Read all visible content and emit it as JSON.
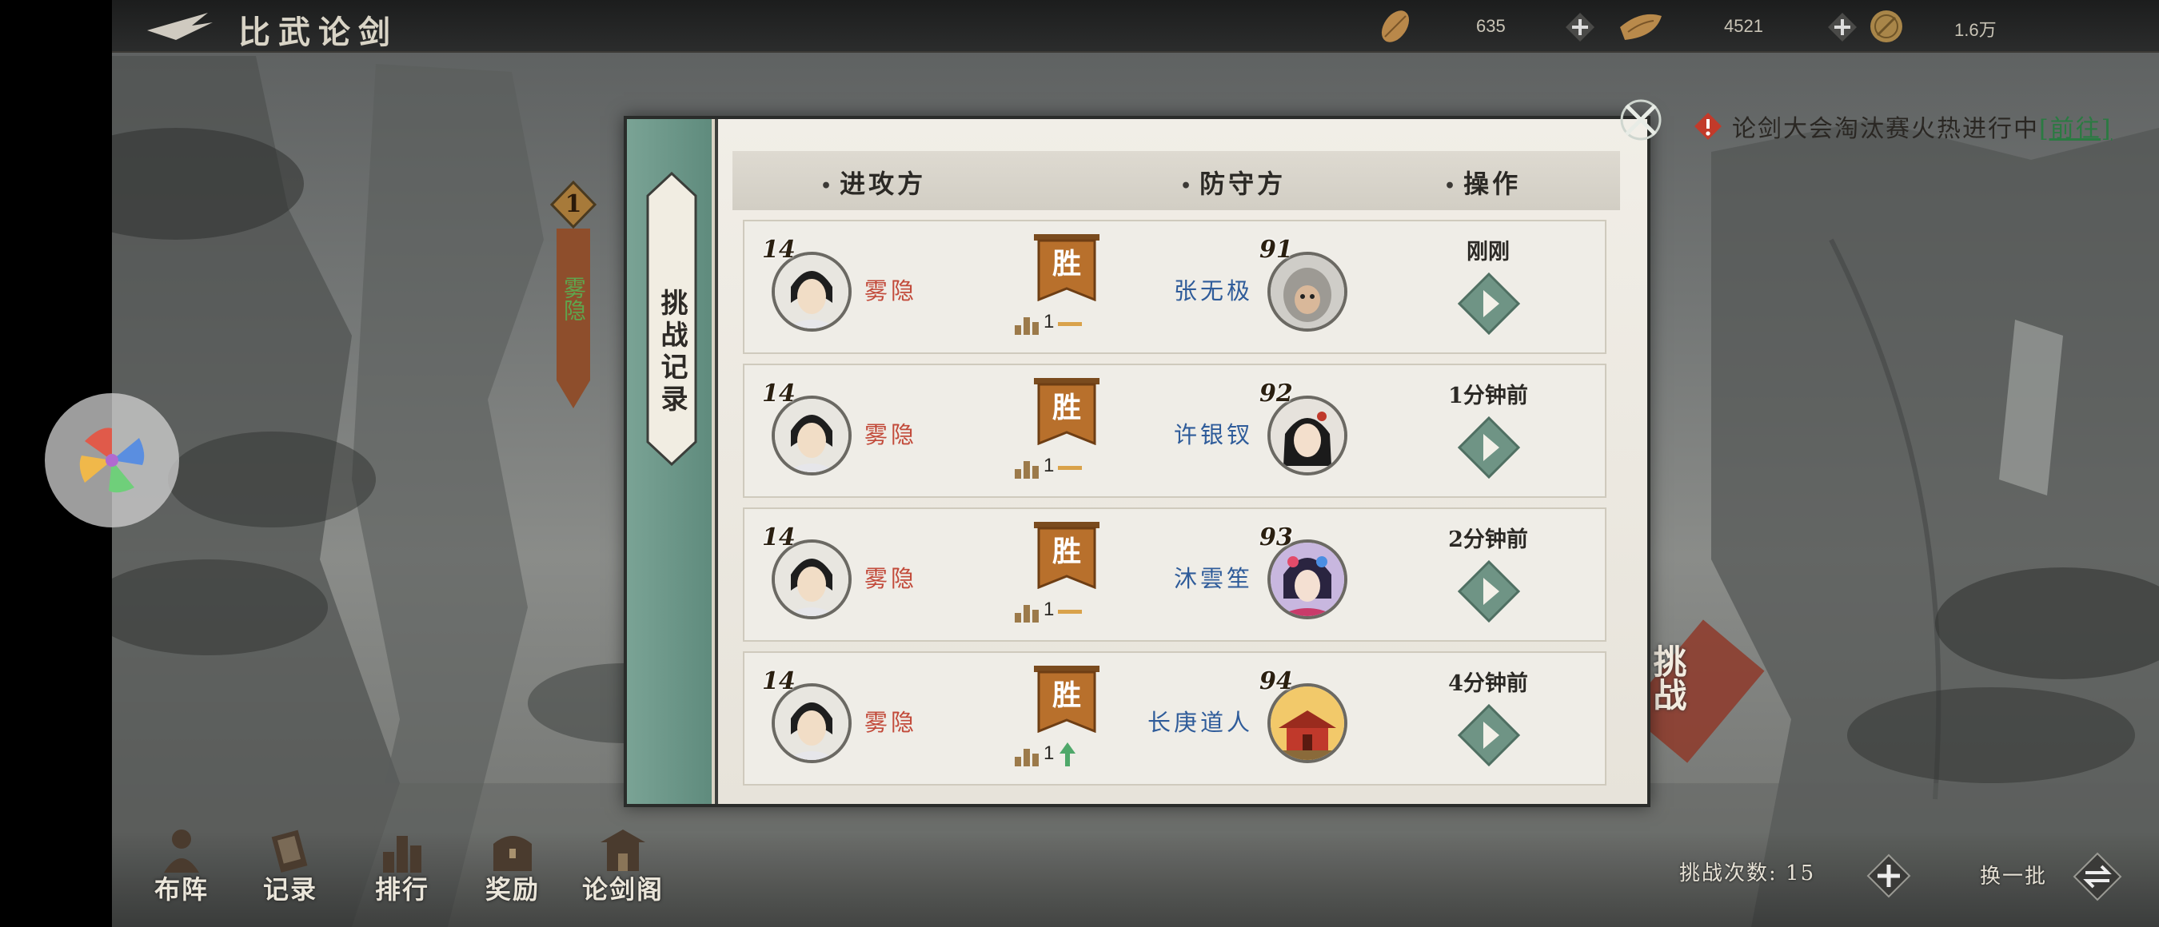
{
  "header": {
    "title": "比武论剑",
    "resources": [
      {
        "icon": "leaf-token-icon",
        "value": "635"
      },
      {
        "icon": "gold-ingot-icon",
        "value": "4521"
      },
      {
        "icon": "jade-coin-icon",
        "value": "1.6万"
      }
    ]
  },
  "notice": {
    "text": "论剑大会淘汰赛火热进行中",
    "link": "[前往]"
  },
  "rank_flag": {
    "rank": "1",
    "name": "雾隐"
  },
  "dialog": {
    "tab_label": "挑战记录",
    "columns": {
      "attacker": "进攻方",
      "defender": "防守方",
      "action": "操作"
    },
    "records": [
      {
        "atk_level": "14",
        "atk_name": "雾隐",
        "result": "胜",
        "rank_change": "1",
        "rank_trend": "same",
        "def_level": "91",
        "def_name": "张无极",
        "time": "刚刚"
      },
      {
        "atk_level": "14",
        "atk_name": "雾隐",
        "result": "胜",
        "rank_change": "1",
        "rank_trend": "same",
        "def_level": "92",
        "def_name": "许银钗",
        "time": "1分钟前"
      },
      {
        "atk_level": "14",
        "atk_name": "雾隐",
        "result": "胜",
        "rank_change": "1",
        "rank_trend": "same",
        "def_level": "93",
        "def_name": "沐雲笙",
        "time": "2分钟前"
      },
      {
        "atk_level": "14",
        "atk_name": "雾隐",
        "result": "胜",
        "rank_change": "1",
        "rank_trend": "up",
        "def_level": "94",
        "def_name": "长庚道人",
        "time": "4分钟前"
      }
    ]
  },
  "bottom_nav": [
    {
      "label": "布阵",
      "icon": "formation-icon"
    },
    {
      "label": "记录",
      "icon": "record-icon"
    },
    {
      "label": "排行",
      "icon": "ranking-icon"
    },
    {
      "label": "奖励",
      "icon": "reward-chest-icon"
    },
    {
      "label": "论剑阁",
      "icon": "pavilion-icon"
    }
  ],
  "challenge": {
    "label": "挑战次数:",
    "count": "15"
  },
  "swap": {
    "label": "换一批"
  },
  "side_char_name": "挑战",
  "colors": {
    "win_banner": "#b8702c",
    "attacker_name": "#c24a3a",
    "defender_name": "#2f5c9a",
    "action_button": "#6f9485"
  }
}
